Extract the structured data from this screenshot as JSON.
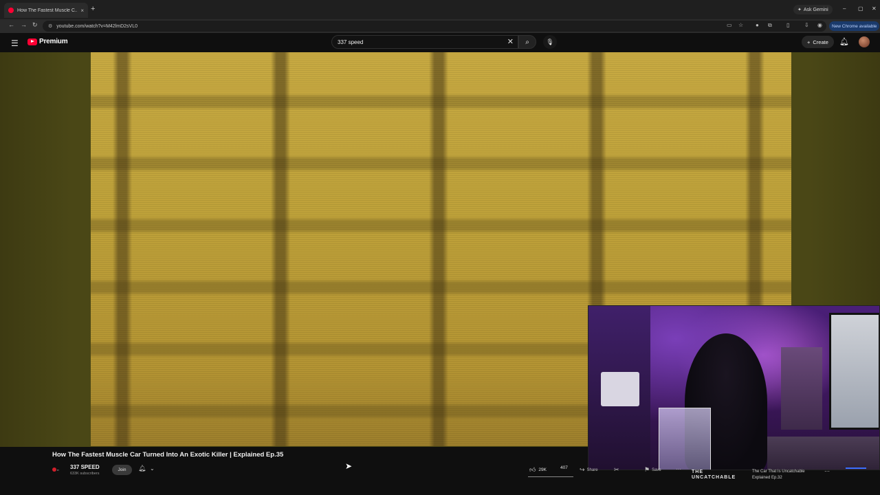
{
  "browser": {
    "tab_title": "How The Fastest Muscle C...",
    "tab_close": "×",
    "new_tab": "+",
    "ask_gemini": "Ask Gemini",
    "url": "youtube.com/watch?v=M42lmD2sVL0",
    "new_chrome": "New Chrome available",
    "window_controls": [
      "–",
      "▢",
      "✕"
    ]
  },
  "youtube": {
    "logo_text": "Premium",
    "search_query": "337 speed",
    "clear_glyph": "✕",
    "create_label": "Create"
  },
  "video": {
    "title": "How The Fastest Muscle Car Turned Into An Exotic Killer | Explained Ep.35",
    "channel_name": "337 SPEED",
    "subscribers": "633K subscribers",
    "join_label": "Join",
    "likes": "29K",
    "dislike_count": "407",
    "share_label": "Share",
    "save_label": "Save"
  },
  "up_next": {
    "brand_line1": "THE",
    "brand_line2": "UNCATCHABLE",
    "title_line1": "The Car That Is Uncatchable",
    "title_line2": "Explained Ep.32"
  },
  "icons": {
    "menu": "hamburger-icon",
    "search": "search-icon",
    "mic": "microphone-icon",
    "bell": "bell-icon",
    "like": "thumbs-up-icon",
    "share": "share-icon",
    "save": "bookmark-icon"
  },
  "colors": {
    "brand_red": "#ff0033",
    "page_bg": "#0f0f0f",
    "chrome_update_bg": "#1a3a6b"
  }
}
